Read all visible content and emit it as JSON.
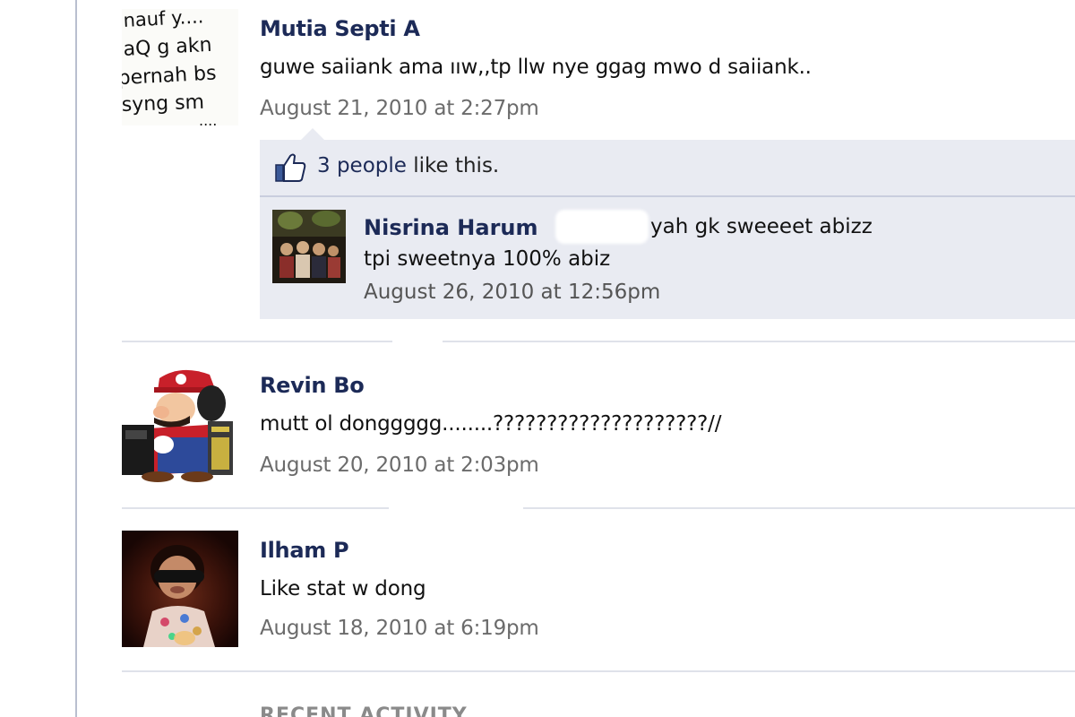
{
  "posts": [
    {
      "author": "Mutia Septi A",
      "message": "guwe saiiank ama ııw,,tp llw nye ggag mwo d saiiank..",
      "timestamp": "August 21, 2010 at 2:27pm",
      "avatar_text": [
        "nauf y....",
        "aQ g akn",
        "pernah bs",
        "syng sm",
        "...."
      ]
    },
    {
      "author": "Revin Bo",
      "message": "mutt ol donggggg........????????????????????//",
      "timestamp": "August 20, 2010 at 2:03pm"
    },
    {
      "author": "Ilham P",
      "message": "Like stat w dong",
      "timestamp": "August 18, 2010 at 6:19pm"
    }
  ],
  "likes": {
    "count_label": "3 people",
    "suffix": " like this."
  },
  "reply": {
    "author": "Nisrina Harum",
    "text_line1": "yah gk sweeeet abizz",
    "text_line2": "tpi sweetnya 100% abiz",
    "timestamp": "August 26, 2010 at 12:56pm"
  },
  "section": {
    "title": "RECENT ACTIVITY"
  },
  "colors": {
    "author_name": "#1c2a57",
    "timestamp": "#6b6b6b",
    "ufi_background": "#e9ebf2",
    "divider": "#dfe2ea"
  }
}
